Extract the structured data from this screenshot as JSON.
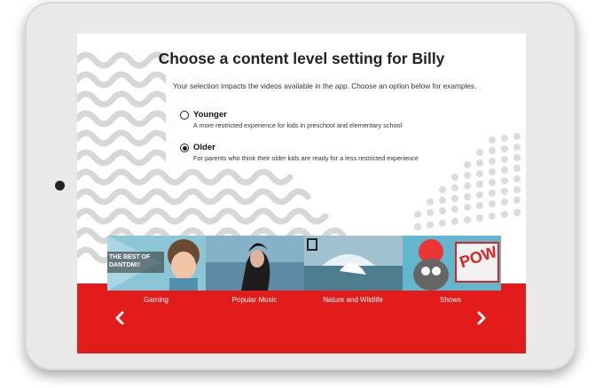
{
  "page": {
    "title": "Choose a content level setting for Billy",
    "intro": "Your selection impacts the videos available in the app. Choose an option below for examples."
  },
  "options": [
    {
      "label": "Younger",
      "description": "A more restricted experience for kids in preschool and  elementary school",
      "selected": false
    },
    {
      "label": "Older",
      "description": "For parents who think their older kids are ready for a less restricted experience",
      "selected": true
    }
  ],
  "carousel": {
    "categories": [
      "Gaming",
      "Popular Music",
      "Nature and Wildlife",
      "Shows"
    ],
    "thumbnail_texts": {
      "gaming": "THE BEST OF DANTDM!!",
      "shows": "POW"
    }
  },
  "colors": {
    "accent": "#e21b1b",
    "decor": "#d4d4d4"
  },
  "icons": [
    "chevron-left-icon",
    "chevron-right-icon"
  ]
}
